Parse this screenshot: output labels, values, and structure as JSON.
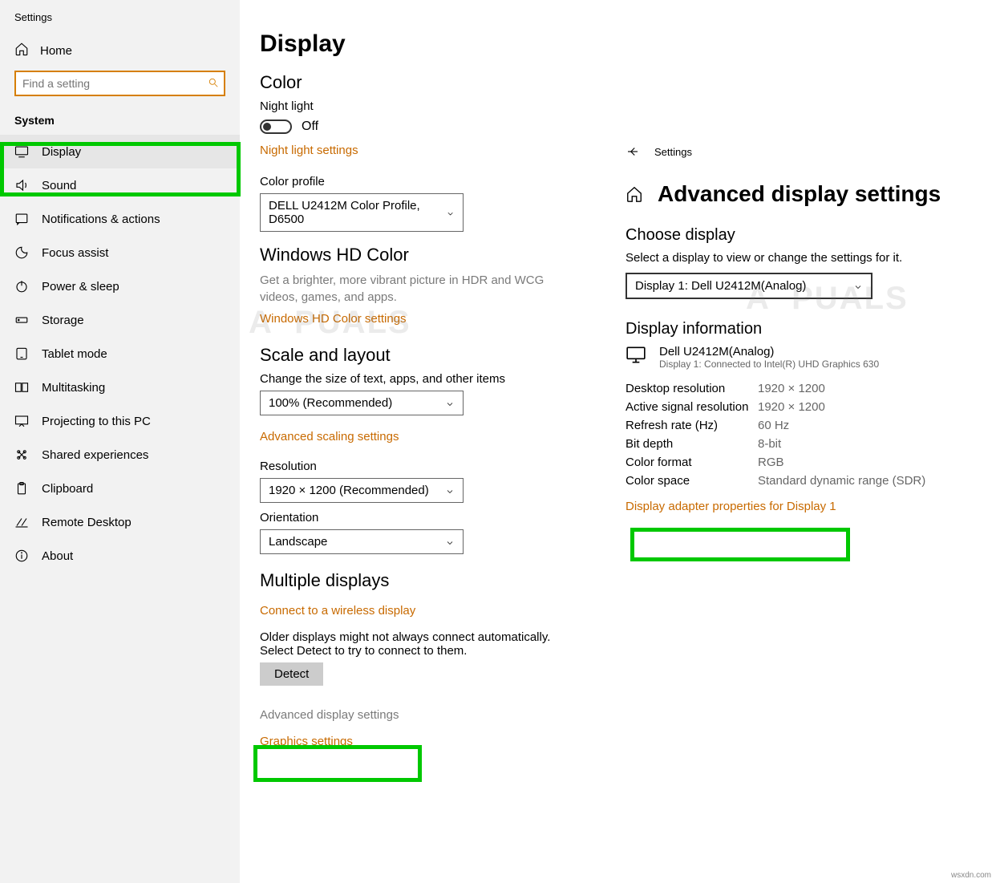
{
  "sidebar": {
    "window_title": "Settings",
    "home": "Home",
    "search_placeholder": "Find a setting",
    "section": "System",
    "items": [
      {
        "label": "Display"
      },
      {
        "label": "Sound"
      },
      {
        "label": "Notifications & actions"
      },
      {
        "label": "Focus assist"
      },
      {
        "label": "Power & sleep"
      },
      {
        "label": "Storage"
      },
      {
        "label": "Tablet mode"
      },
      {
        "label": "Multitasking"
      },
      {
        "label": "Projecting to this PC"
      },
      {
        "label": "Shared experiences"
      },
      {
        "label": "Clipboard"
      },
      {
        "label": "Remote Desktop"
      },
      {
        "label": "About"
      }
    ]
  },
  "main": {
    "title": "Display",
    "color_heading": "Color",
    "night_light_label": "Night light",
    "night_light_status": "Off",
    "night_light_link": "Night light settings",
    "color_profile_label": "Color profile",
    "color_profile_value": "DELL U2412M Color Profile, D6500",
    "hd_heading": "Windows HD Color",
    "hd_desc": "Get a brighter, more vibrant picture in HDR and WCG videos, games, and apps.",
    "hd_link": "Windows HD Color settings",
    "scale_heading": "Scale and layout",
    "scale_label": "Change the size of text, apps, and other items",
    "scale_value": "100% (Recommended)",
    "scale_link": "Advanced scaling settings",
    "resolution_label": "Resolution",
    "resolution_value": "1920 × 1200 (Recommended)",
    "orientation_label": "Orientation",
    "orientation_value": "Landscape",
    "multi_heading": "Multiple displays",
    "connect_link": "Connect to a wireless display",
    "detect_desc": "Older displays might not always connect automatically. Select Detect to try to connect to them.",
    "detect_btn": "Detect",
    "adv_display_link": "Advanced display settings",
    "graphics_link": "Graphics settings"
  },
  "right": {
    "back_label": "Settings",
    "title": "Advanced display settings",
    "choose_heading": "Choose display",
    "choose_sub": "Select a display to view or change the settings for it.",
    "display_select": "Display 1: Dell U2412M(Analog)",
    "info_heading": "Display information",
    "monitor_name": "Dell U2412M(Analog)",
    "monitor_sub": "Display 1: Connected to Intel(R) UHD Graphics 630",
    "rows": [
      {
        "k": "Desktop resolution",
        "v": "1920 × 1200"
      },
      {
        "k": "Active signal resolution",
        "v": "1920 × 1200"
      },
      {
        "k": "Refresh rate (Hz)",
        "v": "60 Hz"
      },
      {
        "k": "Bit depth",
        "v": "8-bit"
      },
      {
        "k": "Color format",
        "v": "RGB"
      },
      {
        "k": "Color space",
        "v": "Standard dynamic range (SDR)"
      }
    ],
    "adapter_link": "Display adapter properties for Display 1"
  },
  "footer": "wsxdn.com"
}
